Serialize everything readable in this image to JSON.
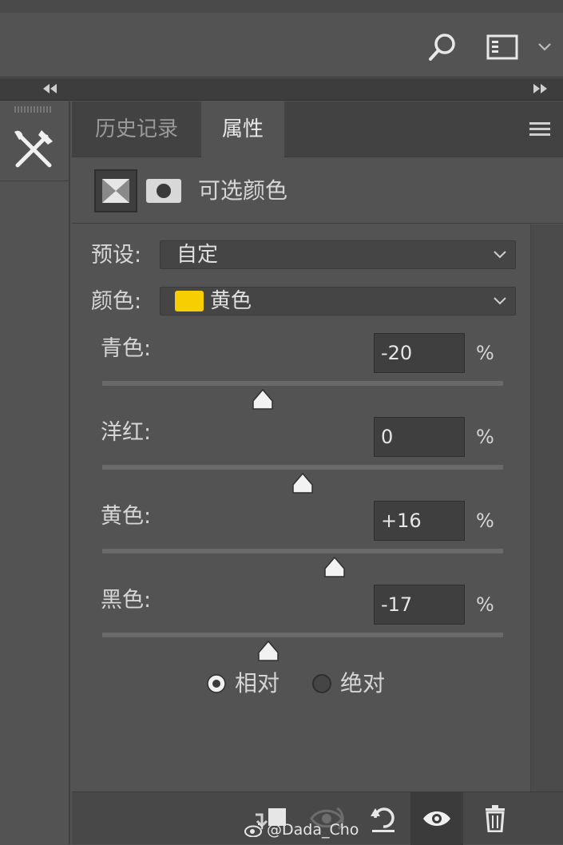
{
  "tabs": {
    "history": "历史记录",
    "properties": "属性"
  },
  "adjustment": {
    "title": "可选颜色"
  },
  "preset": {
    "label": "预设:",
    "value": "自定"
  },
  "colors": {
    "label": "颜色:",
    "value": "黄色",
    "swatch": "#f7cf00"
  },
  "sliders": [
    {
      "label": "青色:",
      "value": "-20",
      "unit": "%",
      "level": -20
    },
    {
      "label": "洋红:",
      "value": "0",
      "unit": "%",
      "level": 0
    },
    {
      "label": "黄色:",
      "value": "+16",
      "unit": "%",
      "level": 16
    },
    {
      "label": "黑色:",
      "value": "-17",
      "unit": "%",
      "level": -17
    }
  ],
  "method": {
    "relative": "相对",
    "absolute": "绝对",
    "selected": "relative"
  },
  "watermark": "@Dada_Cho",
  "icons": {
    "search": "search-icon",
    "workspace": "workspace-icon",
    "tool": "crossed-tools-icon",
    "menu": "panel-menu-icon",
    "clip": "clip-to-layer-icon",
    "view_prev": "view-previous-icon",
    "reset": "reset-icon",
    "visibility": "eye-icon",
    "delete": "trash-icon"
  },
  "theme": {
    "panel": "#535353",
    "tabbar": "#424242",
    "accent": "#f7cf00"
  }
}
